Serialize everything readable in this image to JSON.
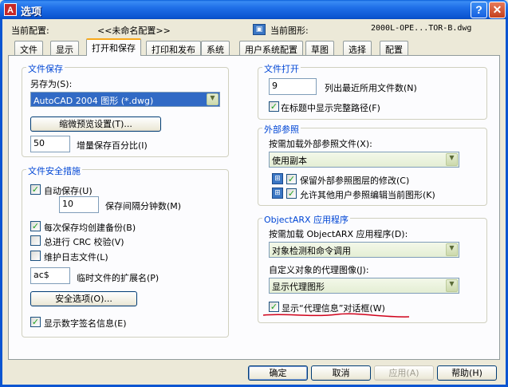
{
  "window": {
    "title": "选项",
    "icon_glyph": "A",
    "help_glyph": "?",
    "close_glyph": "✕"
  },
  "profile": {
    "label": "当前配置:",
    "value": "<<未命名配置>>",
    "drawing_label": "当前图形:",
    "drawing_value": "2000L-OPE...TOR-B.dwg"
  },
  "tabs": [
    "文件",
    "显示",
    "打开和保存",
    "打印和发布",
    "系统",
    "用户系统配置",
    "草图",
    "选择",
    "配置"
  ],
  "file_save": {
    "title": "文件保存",
    "save_as_label": "另存为(S):",
    "save_as_value": "AutoCAD 2004 图形 (*.dwg)",
    "thumbnail_button": "缩微预览设置(T)...",
    "incremental_value": "50",
    "incremental_label": "增量保存百分比(I)"
  },
  "safety": {
    "title": "文件安全措施",
    "autosave_label": "自动保存(U)",
    "autosave_minutes_value": "10",
    "autosave_minutes_label": "保存间隔分钟数(M)",
    "backup_label": "每次保存均创建备份(B)",
    "crc_label": "总进行 CRC 校验(V)",
    "log_label": "维护日志文件(L)",
    "temp_ext_value": "ac$",
    "temp_ext_label": "临时文件的扩展名(P)",
    "security_button": "安全选项(O)...",
    "signature_label": "显示数字签名信息(E)"
  },
  "file_open": {
    "title": "文件打开",
    "recent_value": "9",
    "recent_label": "列出最近所用文件数(N)",
    "fullpath_label": "在标题中显示完整路径(F)"
  },
  "xref": {
    "title": "外部参照",
    "demand_label": "按需加载外部参照文件(X):",
    "demand_value": "使用副本",
    "retain_label": "保留外部参照图层的修改(C)",
    "allow_edit_label": "允许其他用户参照编辑当前图形(K)"
  },
  "objectarx": {
    "title": "ObjectARX 应用程序",
    "demand_label": "按需加载 ObjectARX 应用程序(D):",
    "demand_value": "对象检测和命令调用",
    "proxy_label": "自定义对象的代理图像(J):",
    "proxy_value": "显示代理图形",
    "show_proxy_label": "显示“代理信息”对话框(W)"
  },
  "footer": {
    "ok": "确定",
    "cancel": "取消",
    "apply": "应用(A)",
    "help": "帮助(H)"
  },
  "colors": {
    "titlebar": "#0b55d1",
    "group_title": "#0046d5",
    "annotation": "#d0021b"
  },
  "checkmark": "✓"
}
